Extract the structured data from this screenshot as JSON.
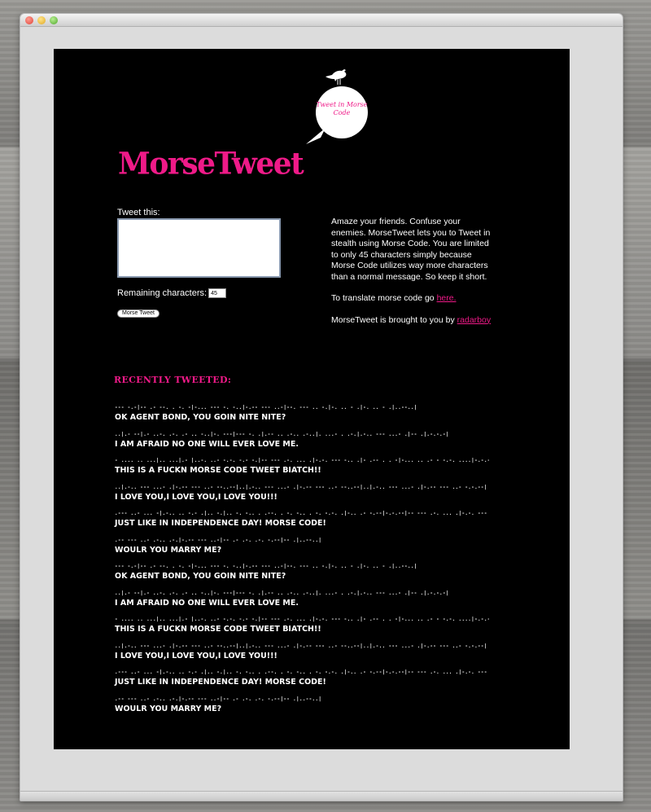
{
  "app": {
    "logo": "MorseTweet",
    "bubble_text": "Tweet in Morse Code"
  },
  "form": {
    "tweet_label": "Tweet this:",
    "tweet_value": "",
    "remaining_label": "Remaining characters:",
    "remaining_value": "45",
    "button_label": "Morse Tweet"
  },
  "description": {
    "intro": "Amaze your friends. Confuse your enemies. MorseTweet lets you to Tweet in stealth using Morse Code. You are limited to only 45 characters simply because Morse Code utilizes way more characters than a normal message. So keep it short.",
    "translate_prefix": "To translate morse code go ",
    "translate_link": "here.",
    "credit_prefix": "MorseTweet is brought to you by ",
    "credit_link": "radarboy"
  },
  "recent": {
    "heading": "RECENTLY TWEETED:",
    "tweets": [
      {
        "morse": "--- -.-|-- .- --. . -. -|-... --- -. -..|-.-- --- ..-|--. --- .. -.|-. .. - .|-. .. - .|..--..|",
        "text": "  OK AGENT BOND, YOU GOIN NITE NITE?"
      },
      {
        "morse": "..|.- --|.- ..-. .-. .- .. -..|-. ---|--- -. .|.-- .. .-.. .-..|. ...- . .-.|.-.. --- ...- .|-- .|.-.-.-|",
        "text": "I AM AFRAID NO ONE WILL EVER LOVE ME."
      },
      {
        "morse": "- .... .. ...|.. ...|.- |..-. ..- -.-. -.- -.|-- --- .-. ... .|-.-. --- -.. .|- .-- . . -|-... .. .- - -.-. ....|-.-.--|",
        "text": "THIS IS A FUCKN MORSE CODE TWEET BIATCH!!"
      },
      {
        "morse": "..|.-.. --- ...- .|-.-- --- ..- --..--|..|.-.. --- ...- .|-.-- --- ..- --..--|..|.-.. --- ...- .|-.-- --- ..- -.-.--|",
        "text": "I LOVE YOU,I LOVE YOU,I LOVE YOU!!!"
      },
      {
        "morse": ".--- ..- ... -|.-.. .. -.- .|.. -.|.. -. -.. . .--. . -. -.. . -. -.-. .|-.. .- -.--|-.-.--|-- --- .-. ... .|-.-. --- -.. .|-.-.--|",
        "text": "JUST LIKE IN INDEPENDENCE DAY! MORSE CODE!"
      },
      {
        "morse": ".-- --- ..- .-.. .-.|-.-- --- ..-|-- .- .-. .-. -.--|-- .|..--..|",
        "text": "WOULR YOU MARRY ME?"
      },
      {
        "morse": "--- -.-|-- .- --. . -. -|-... --- -. -..|-.-- --- ..-|--. --- .. -.|-. .. - .|-. .. - .|..--..|",
        "text": "  OK AGENT BOND, YOU GOIN NITE NITE?"
      },
      {
        "morse": "..|.- --|.- ..-. .-. .- .. -..|-. ---|--- -. .|.-- .. .-.. .-..|. ...- . .-.|.-.. --- ...- .|-- .|.-.-.-|",
        "text": "I AM AFRAID NO ONE WILL EVER LOVE ME."
      },
      {
        "morse": "- .... .. ...|.. ...|.- |..-. ..- -.-. -.- -.|-- --- .-. ... .|-.-. --- -.. .|- .-- . . -|-... .. .- - -.-. ....|-.-.--|",
        "text": "THIS IS A FUCKN MORSE CODE TWEET BIATCH!!"
      },
      {
        "morse": "..|.-.. --- ...- .|-.-- --- ..- --..--|..|.-.. --- ...- .|-.-- --- ..- --..--|..|.-.. --- ...- .|-.-- --- ..- -.-.--|",
        "text": "I LOVE YOU,I LOVE YOU,I LOVE YOU!!!"
      },
      {
        "morse": ".--- ..- ... -|.-.. .. -.- .|.. -.|.. -. -.. . .--. . -. -.. . -. -.-. .|-.. .- -.--|-.-.--|-- --- .-. ... .|-.-. --- -.. .|-.-.--|",
        "text": "JUST LIKE IN INDEPENDENCE DAY! MORSE CODE!"
      },
      {
        "morse": ".-- --- ..- .-.. .-.|-.-- --- ..-|-- .- .-. .-. -.--|-- .|..--..|",
        "text": "WOULR YOU MARRY ME?"
      }
    ]
  },
  "colors": {
    "accent": "#ef1a88",
    "page_bg": "#000000",
    "text": "#ffffff"
  }
}
